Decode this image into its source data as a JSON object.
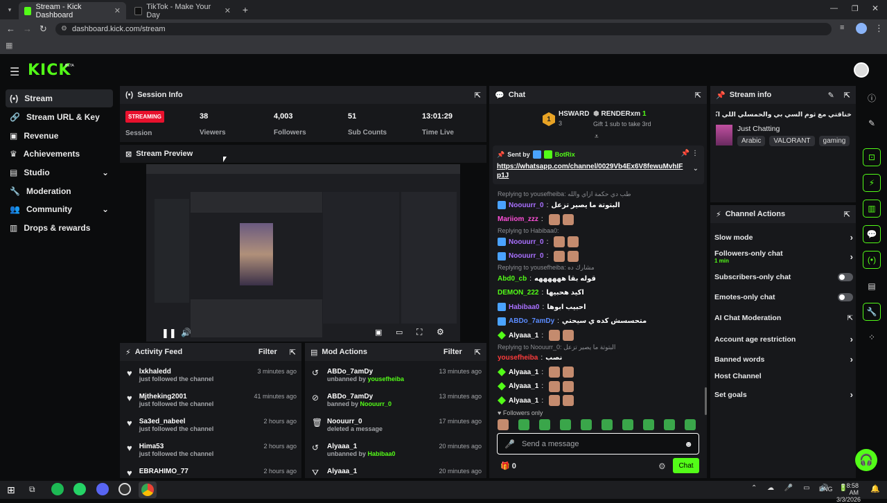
{
  "browser": {
    "tabs": [
      {
        "title": "Stream - Kick Dashboard"
      },
      {
        "title": "TikTok - Make Your Day"
      }
    ],
    "url": "dashboard.kick.com/stream"
  },
  "brand": {
    "logo": "KICK",
    "beta": "BETA",
    "accent": "#53fc18"
  },
  "sidebar": {
    "items": [
      {
        "label": "Stream",
        "icon": "broadcast-icon"
      },
      {
        "label": "Stream URL & Key",
        "icon": "key-icon"
      },
      {
        "label": "Revenue",
        "icon": "money-icon"
      },
      {
        "label": "Achievements",
        "icon": "trophy-icon"
      },
      {
        "label": "Studio",
        "icon": "studio-icon"
      },
      {
        "label": "Moderation",
        "icon": "wrench-icon"
      },
      {
        "label": "Community",
        "icon": "community-icon"
      },
      {
        "label": "Drops & rewards",
        "icon": "gift-icon"
      }
    ]
  },
  "session": {
    "title": "Session Info",
    "status": "STREAMING",
    "status_label": "Session",
    "stats": [
      {
        "value": "38",
        "label": "Viewers"
      },
      {
        "value": "4,003",
        "label": "Followers"
      },
      {
        "value": "51",
        "label": "Sub Counts"
      },
      {
        "value": "13:01:29",
        "label": "Time Live"
      }
    ]
  },
  "preview": {
    "title": "Stream Preview"
  },
  "activity": {
    "title": "Activity Feed",
    "filter": "Filter",
    "rows": [
      {
        "user": "lxkhaledd",
        "action": "just followed the channel",
        "time": "3 minutes ago"
      },
      {
        "user": "Mjtheking2001",
        "action": "just followed the channel",
        "time": "41 minutes ago"
      },
      {
        "user": "Sa3ed_nabeel",
        "action": "just followed the channel",
        "time": "2 hours ago"
      },
      {
        "user": "Hima53",
        "action": "just followed the channel",
        "time": "2 hours ago"
      },
      {
        "user": "EBRAHIMO_77",
        "action": "",
        "time": "2 hours ago"
      }
    ]
  },
  "mod": {
    "title": "Mod Actions",
    "filter": "Filter",
    "rows": [
      {
        "user": "ABDo_7amDy",
        "action": "unbanned by ",
        "by": "yousefheiba",
        "time": "13 minutes ago",
        "icon": "undo-icon"
      },
      {
        "user": "ABDo_7amDy",
        "action": "banned by ",
        "by": "Noouurr_0",
        "time": "13 minutes ago",
        "icon": "ban-icon"
      },
      {
        "user": "Noouurr_0",
        "action": "deleted a message",
        "by": "",
        "time": "17 minutes ago",
        "icon": "trash-icon"
      },
      {
        "user": "Alyaaa_1",
        "action": "unbanned by ",
        "by": "Habibaa0",
        "time": "20 minutes ago",
        "icon": "undo-icon"
      },
      {
        "user": "Alyaaa_1",
        "action": "",
        "by": "",
        "time": "20 minutes ago",
        "icon": "filter-icon"
      }
    ]
  },
  "chat": {
    "title": "Chat",
    "leader1": {
      "name": "HSWARD",
      "count": "3",
      "rank": "1"
    },
    "leader2": {
      "name": "RENDERxm",
      "count": "1",
      "note": "Gift 1 sub to take 3rd"
    },
    "pinned": {
      "sent_by": "Sent by",
      "user": "BotRix",
      "link": "https://whatsapp.com/channel/0029Vb4Ex6V8fewuMvhIF p1J"
    },
    "lines": [
      {
        "reply": "Replying to yousefheiba: طب دي حكمة ازاي والله"
      },
      {
        "user": "Noouurr_0",
        "color": "#a970ff",
        "text": "البتوتة ما يصير تزعل"
      },
      {
        "user": "Mariiom_zzz",
        "color": "#ff4fd8",
        "text": ""
      },
      {
        "reply": "Replying to Habibaa0:"
      },
      {
        "user": "Noouurr_0",
        "color": "#a970ff",
        "text": ""
      },
      {
        "user": "Noouurr_0",
        "color": "#a970ff",
        "text": ""
      },
      {
        "reply": "Replying to yousefheiba: مشارك ده"
      },
      {
        "user": "Abd0_cb",
        "color": "#53fc18",
        "text": "قوله بقا ههههههه"
      },
      {
        "user": "DEMON_222",
        "color": "#53fc18",
        "text": "اكيد هحبيها"
      },
      {
        "user": "Habibaa0",
        "color": "#a970ff",
        "text": "احبيب ابوها"
      },
      {
        "user": "ABDo_7amDy",
        "color": "#5b8cff",
        "text": "متحسسش كده ي سيحتي"
      },
      {
        "user": "Alyaaa_1",
        "color": "#ffffff",
        "text": ""
      },
      {
        "reply": "Replying to Noouurr_0: البتوتة ما يصير تزعل"
      },
      {
        "user": "yousefheiba",
        "color": "#ff3b3b",
        "text": "نصب"
      },
      {
        "user": "Alyaaa_1",
        "color": "#ffffff",
        "text": ""
      },
      {
        "user": "Alyaaa_1",
        "color": "#ffffff",
        "text": ""
      },
      {
        "user": "Alyaaa_1",
        "color": "#ffffff",
        "text": ""
      }
    ],
    "followers_only": "Followers only",
    "placeholder": "Send a message",
    "count": "0",
    "send": "Chat"
  },
  "streaminfo": {
    "title": "Stream info",
    "stream_title": "خناقتي مع ثوم السي بي والحمسلي اللي اكس تمثل تمثل",
    "category": "Just Chatting",
    "tags": [
      "Arabic",
      "VALORANT",
      "gaming"
    ]
  },
  "actions": {
    "title": "Channel Actions",
    "rows": [
      {
        "label": "Slow mode",
        "sub": "",
        "kind": "chevron"
      },
      {
        "label": "Followers-only chat",
        "sub": "1 min",
        "kind": "chevron"
      },
      {
        "label": "Subscribers-only chat",
        "sub": "",
        "kind": "toggle"
      },
      {
        "label": "Emotes-only chat",
        "sub": "",
        "kind": "toggle"
      },
      {
        "label": "AI Chat Moderation",
        "sub": "",
        "kind": "external"
      },
      {
        "label": "Account age restriction",
        "sub": "",
        "kind": "chevron"
      },
      {
        "label": "Banned words",
        "sub": "",
        "kind": "chevron"
      },
      {
        "label": "Host Channel",
        "sub": "",
        "kind": "none"
      },
      {
        "label": "Set goals",
        "sub": "",
        "kind": "chevron"
      }
    ]
  },
  "taskbar": {
    "lang": "ENG",
    "time": "8:58 AM",
    "date": "3/3/2026"
  }
}
